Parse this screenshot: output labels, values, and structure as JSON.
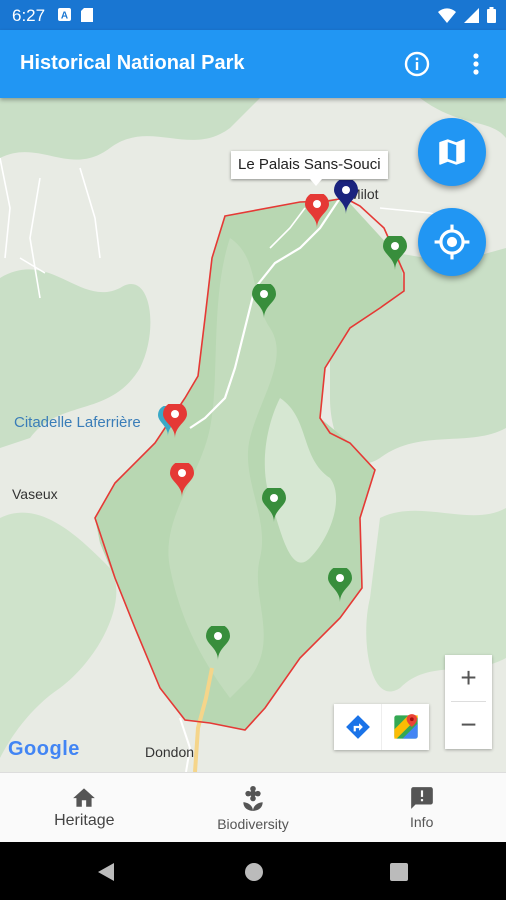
{
  "status_bar": {
    "time": "6:27"
  },
  "app_bar": {
    "title": "Historical National Park"
  },
  "map": {
    "callout": "Le Palais Sans-Souci",
    "place_labels": {
      "milot": "Milot",
      "citadelle": "Citadelle Laferrière",
      "vaseux": "Vaseux",
      "dondon": "Dondon"
    },
    "google_logo": "Google",
    "zoom_in": "+",
    "zoom_out": "−"
  },
  "markers": {
    "heritage_color": "#e53935",
    "biodiversity_color": "#388e3c",
    "selected_color": "#1a237e"
  },
  "boundary_color": "#e53935",
  "bottom_nav": {
    "items": [
      {
        "label": "Heritage",
        "icon": "home-icon",
        "active": true
      },
      {
        "label": "Biodiversity",
        "icon": "biodiversity-icon",
        "active": false
      },
      {
        "label": "Info",
        "icon": "feedback-icon",
        "active": false
      }
    ]
  }
}
